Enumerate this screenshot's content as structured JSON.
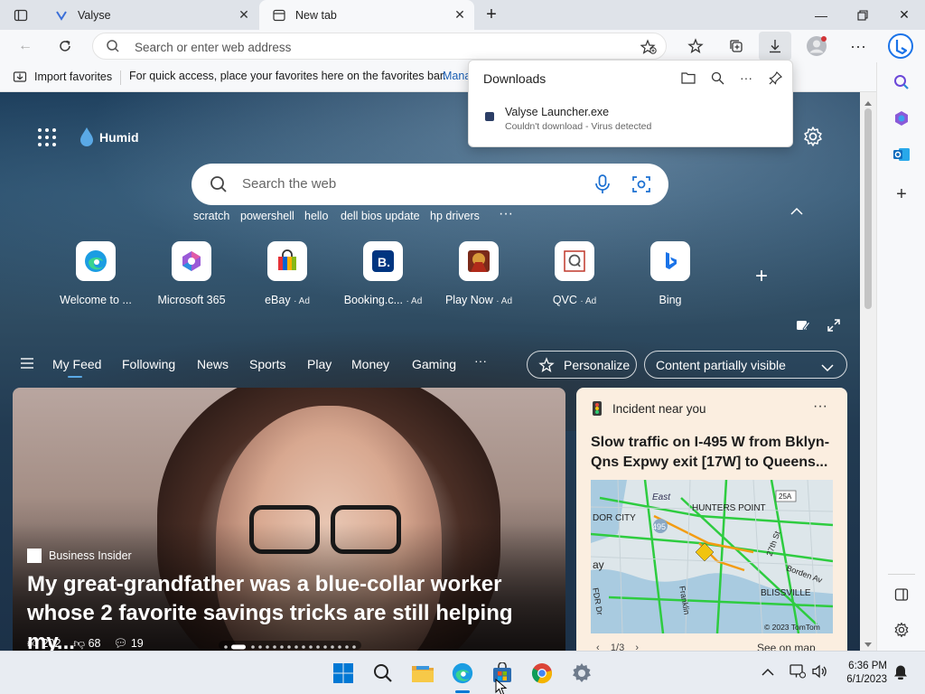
{
  "tabs": [
    {
      "label": "Valyse"
    },
    {
      "label": "New tab"
    }
  ],
  "address": {
    "placeholder": "Search or enter web address"
  },
  "favbar": {
    "import_label": "Import favorites",
    "hint": "For quick access, place your favorites here on the favorites bar.",
    "manage": "Mana"
  },
  "downloads": {
    "title": "Downloads",
    "file_name": "Valyse Launcher.exe",
    "file_status": "Couldn't download - Virus detected"
  },
  "newtab": {
    "weather": "Humid",
    "search_placeholder": "Search the web",
    "suggestions": [
      "scratch",
      "powershell",
      "hello",
      "dell bios update",
      "hp drivers"
    ],
    "tiles": [
      {
        "label": "Welcome to ...",
        "ad": ""
      },
      {
        "label": "Microsoft 365",
        "ad": ""
      },
      {
        "label": "eBay",
        "ad": "· Ad"
      },
      {
        "label": "Booking.c...",
        "ad": "· Ad"
      },
      {
        "label": "Play Now",
        "ad": "· Ad"
      },
      {
        "label": "QVC",
        "ad": "· Ad"
      },
      {
        "label": "Bing",
        "ad": ""
      }
    ],
    "feed_tabs": [
      "My Feed",
      "Following",
      "News",
      "Sports",
      "Play",
      "Money",
      "Gaming"
    ],
    "personalize": "Personalize",
    "content_visibility": "Content partially visible"
  },
  "hero": {
    "source": "Business Insider",
    "title": "My great-grandfather was a blue-collar worker whose 2 favorite savings tricks are still helping my...",
    "likes": "202",
    "dislikes": "68",
    "comments": "19"
  },
  "traffic": {
    "header": "Incident near you",
    "headline": "Slow traffic on I-495 W from Bklyn-Qns Expwy exit [17W] to Queens...",
    "map_labels": {
      "east": "East",
      "dor_city": "DOR CITY",
      "hunters_point": "HUNTERS POINT",
      "i495": "495",
      "blissville": "BLISSVILLE",
      "ay": "ay",
      "fdr": "FDR Dr",
      "franklin": "Franklin",
      "borden": "Borden Av",
      "st27": "27th St",
      "r25a": "25A",
      "copyright": "© 2023 TomTom"
    },
    "pager": "1/3",
    "see_map": "See on map"
  },
  "clock": {
    "time": "6:36 PM",
    "date": "6/1/2023"
  },
  "colors": {
    "accent": "#0f6cbd",
    "page_bg": "#274b68",
    "traffic_card": "#fbeee0"
  }
}
